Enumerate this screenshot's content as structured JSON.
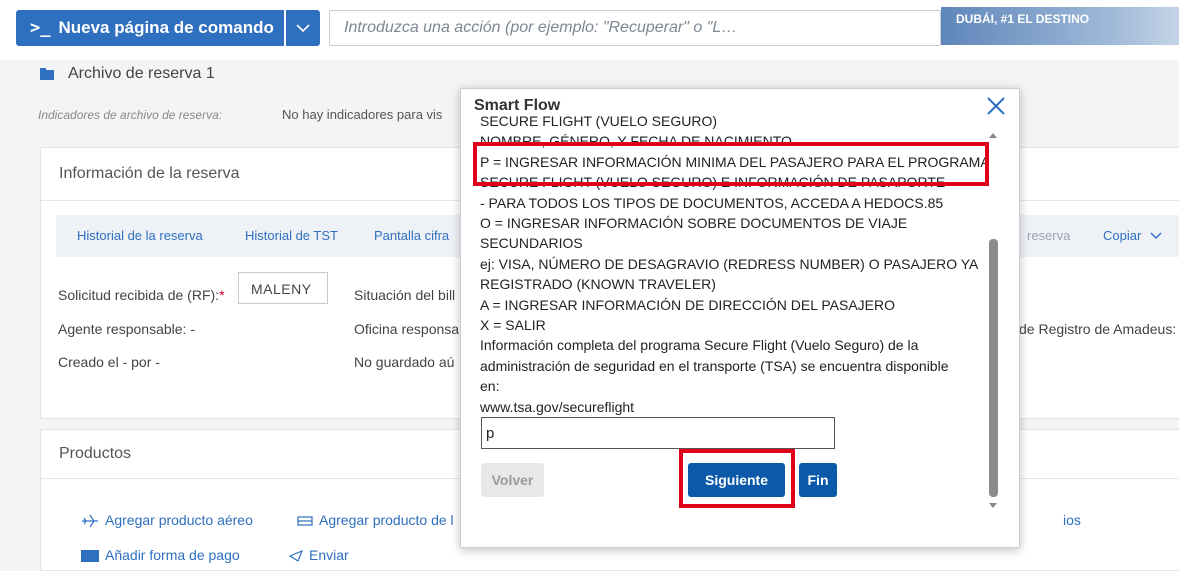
{
  "header": {
    "command_page_prompt": ">_",
    "command_page_label": "Nueva página de comando",
    "action_placeholder": "Introduzca una acción (por ejemplo: \"Recuperar\" o \"L…",
    "promo_text": "DUBÁI, #1 EL DESTINO"
  },
  "booking_file": {
    "title": "Archivo de reserva 1",
    "indicators_label": "Indicadores de archivo de reserva:",
    "indicators_value": "No hay indicadores para vis"
  },
  "booking_info": {
    "title": "Información de la reserva",
    "tabs": [
      "Historial de la reserva",
      "Historial de TST",
      "Pantalla cifra",
      "reserva",
      "Copiar"
    ],
    "rf_label": "Solicitud recibida de (RF):",
    "rf_required_mark": "*",
    "rf_value": "MALENY",
    "ticket_status_label": "Situación del bill",
    "agent_label": "Agente responsable: -",
    "office_label": "Oficina responsa",
    "amadeus_label": "de Registro de Amadeus:",
    "created_label": "Creado el - por -",
    "not_saved_label": "No guardado aú"
  },
  "products": {
    "title": "Productos",
    "add_air": "Agregar producto aéreo",
    "add_other": "Agregar producto de l",
    "services": "ios",
    "add_payment": "Añadir forma de pago",
    "send": "Enviar"
  },
  "modal": {
    "title": "Smart Flow",
    "lines": [
      "SECURE FLIGHT (VUELO SEGURO)",
      "NOMBRE, GÉNERO, Y FECHA DE NACIMIENTO",
      "P = INGRESAR INFORMACIÓN MINIMA DEL PASAJERO PARA EL PROGRAMA",
      "SECURE FLIGHT (VUELO SEGURO) E INFORMACIÓN DE PASAPORTE",
      "- PARA TODOS LOS TIPOS DE DOCUMENTOS, ACCEDA A HEDOCS.85",
      "O = INGRESAR INFORMACIÓN SOBRE DOCUMENTOS DE VIAJE",
      "SECUNDARIOS",
      "ej: VISA, NÚMERO DE DESAGRAVIO (REDRESS NUMBER) O PASAJERO YA",
      "REGISTRADO (KNOWN TRAVELER)",
      "A = INGRESAR INFORMACIÓN DE DIRECCIÓN DEL PASAJERO",
      "X = SALIR",
      "Información completa del programa Secure Flight (Vuelo Seguro) de la",
      "administración de seguridad en el transporte (TSA) se encuentra disponible",
      "en:",
      "www.tsa.gov/secureflight"
    ],
    "input_value": "p",
    "back_button": "Volver",
    "next_button": "Siguiente",
    "finish_button": "Fin"
  },
  "colors": {
    "primary": "#2f6fc0",
    "modal_button": "#0b59a8",
    "highlight": "#e0001b"
  }
}
